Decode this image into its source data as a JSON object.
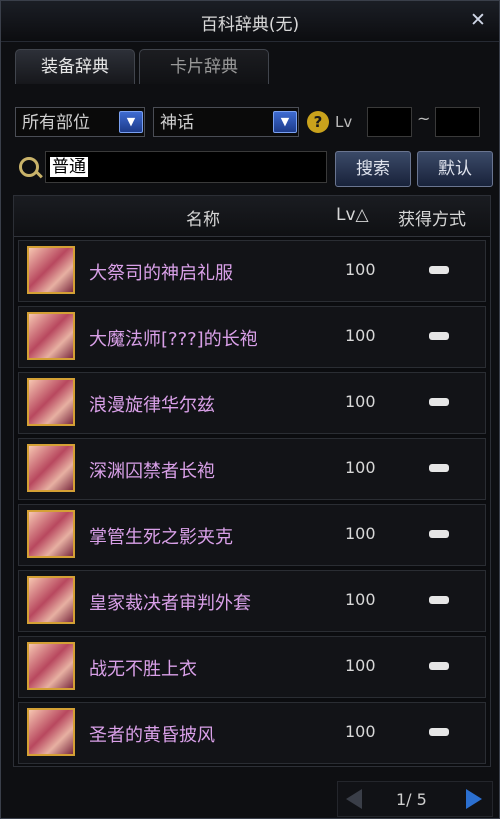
{
  "window": {
    "title": "百科辞典(无)",
    "close_glyph": "✕"
  },
  "tabs": [
    {
      "label": "装备辞典",
      "active": true
    },
    {
      "label": "卡片辞典",
      "active": false
    }
  ],
  "filters": {
    "slot_value": "所有部位",
    "rarity_value": "神话",
    "help_glyph": "?",
    "lv_label": "Lv",
    "lv_min": "",
    "lv_max": "",
    "range_sep": "~"
  },
  "search": {
    "value": "普通",
    "search_label": "搜索",
    "default_label": "默认"
  },
  "table": {
    "headers": {
      "name": "名称",
      "lv": "Lv△",
      "method": "获得方式"
    },
    "rows": [
      {
        "name": "大祭司的神启礼服",
        "lv": "100"
      },
      {
        "name": "大魔法师[???]的长袍",
        "lv": "100"
      },
      {
        "name": "浪漫旋律华尔兹",
        "lv": "100"
      },
      {
        "name": "深渊囚禁者长袍",
        "lv": "100"
      },
      {
        "name": "掌管生死之影夹克",
        "lv": "100"
      },
      {
        "name": "皇家裁决者审判外套",
        "lv": "100"
      },
      {
        "name": "战无不胜上衣",
        "lv": "100"
      },
      {
        "name": "圣者的黄昏披风",
        "lv": "100"
      }
    ]
  },
  "pager": {
    "text": "1/ 5"
  },
  "colors": {
    "item_name": "#d9a0e8",
    "accent_blue": "#2b6fd0",
    "icon_border": "#d4a035"
  }
}
